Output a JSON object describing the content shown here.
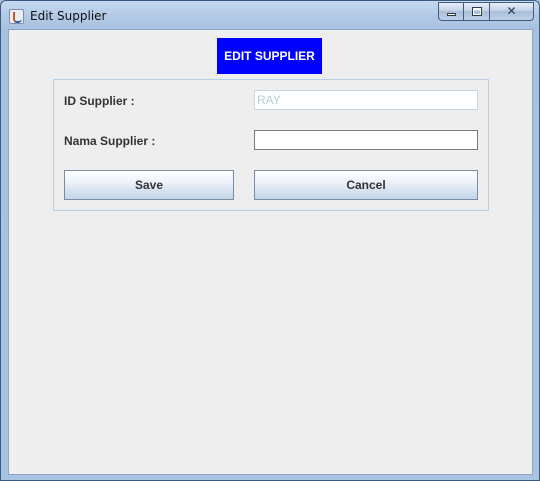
{
  "window": {
    "title": "Edit Supplier",
    "icon": "java-cup-icon",
    "close_glyph": "✕"
  },
  "header": {
    "label": "EDIT SUPPLIER",
    "background_color": "#0000ff",
    "text_color": "#ffffff"
  },
  "form": {
    "id_label": "ID Supplier :",
    "id_value": "RAY",
    "nama_label": "Nama Supplier :",
    "nama_value": ""
  },
  "buttons": {
    "save_label": "Save",
    "cancel_label": "Cancel"
  }
}
